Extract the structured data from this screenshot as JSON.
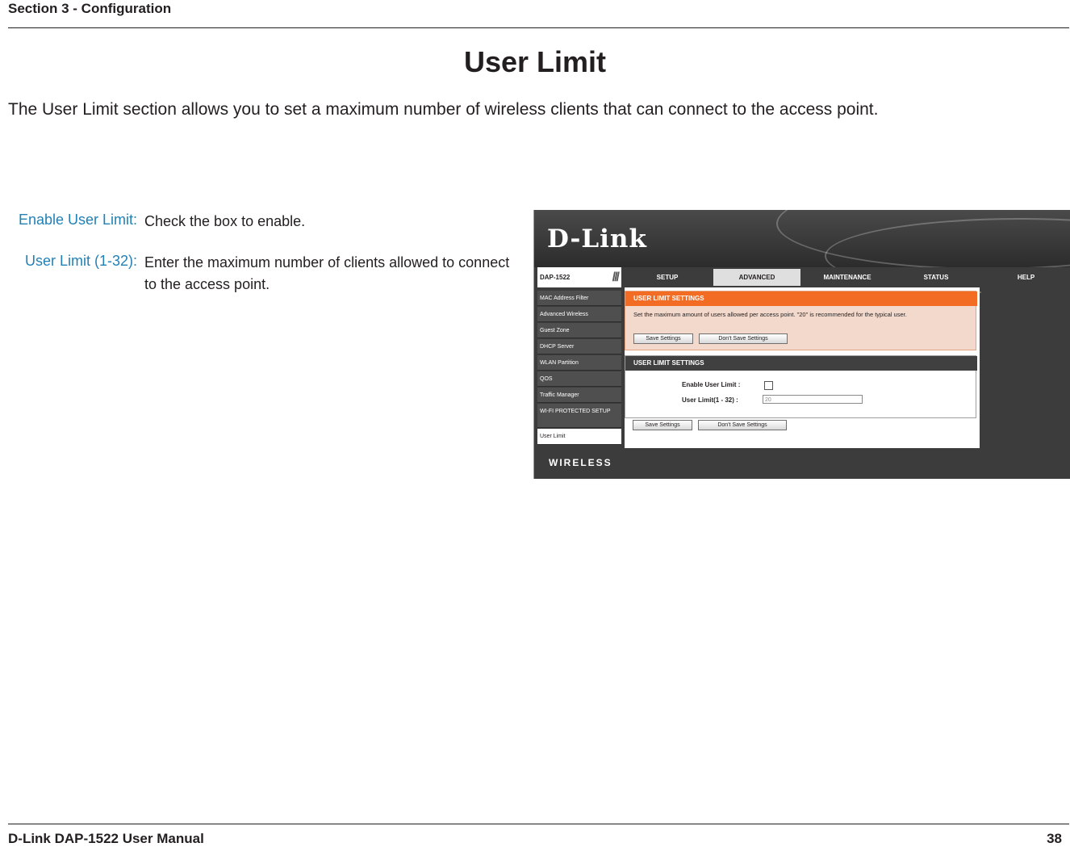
{
  "header": {
    "section": "Section 3 - Configuration",
    "title": "User Limit",
    "intro": "The User Limit section allows you to set a maximum number of wireless clients that can connect to the access point."
  },
  "definitions": [
    {
      "term": "Enable User Limit:",
      "description": "Check the box to enable."
    },
    {
      "term": "User Limit (1-32):",
      "description": "Enter the maximum number of clients allowed to connect to the access point."
    }
  ],
  "router_ui": {
    "logo": "D-Link",
    "model": "DAP-1522",
    "tabs": [
      "SETUP",
      "ADVANCED",
      "MAINTENANCE",
      "STATUS",
      "HELP"
    ],
    "active_tab": "ADVANCED",
    "sidebar": [
      "MAC Address Filter",
      "Advanced Wireless",
      "Guest Zone",
      "DHCP Server",
      "WLAN Partition",
      "QOS",
      "Traffic Manager",
      "WI-FI PROTECTED SETUP",
      "User Limit"
    ],
    "current_item": "User Limit",
    "intro_box": {
      "title": "USER LIMIT SETTINGS",
      "text": "Set the maximum amount of users allowed per access point. \"20\" is recommended for the typical user.",
      "save_button": "Save Settings",
      "dont_save_button": "Don't Save Settings"
    },
    "settings_box": {
      "title": "USER LIMIT SETTINGS",
      "enable_label": "Enable User Limit  :",
      "enable_checked": false,
      "limit_label": "User Limit(1 - 32)  :",
      "limit_value": "20"
    },
    "bottom_buttons": {
      "save": "Save Settings",
      "dont_save": "Don't Save Settings"
    },
    "footer_brand": "WIRELESS",
    "colors": {
      "accent_orange": "#f26c23",
      "dark_header": "#404040",
      "nav_bg": "#3c3c3c"
    }
  },
  "footer": {
    "manual": "D-Link DAP-1522 User Manual",
    "page": "38"
  }
}
